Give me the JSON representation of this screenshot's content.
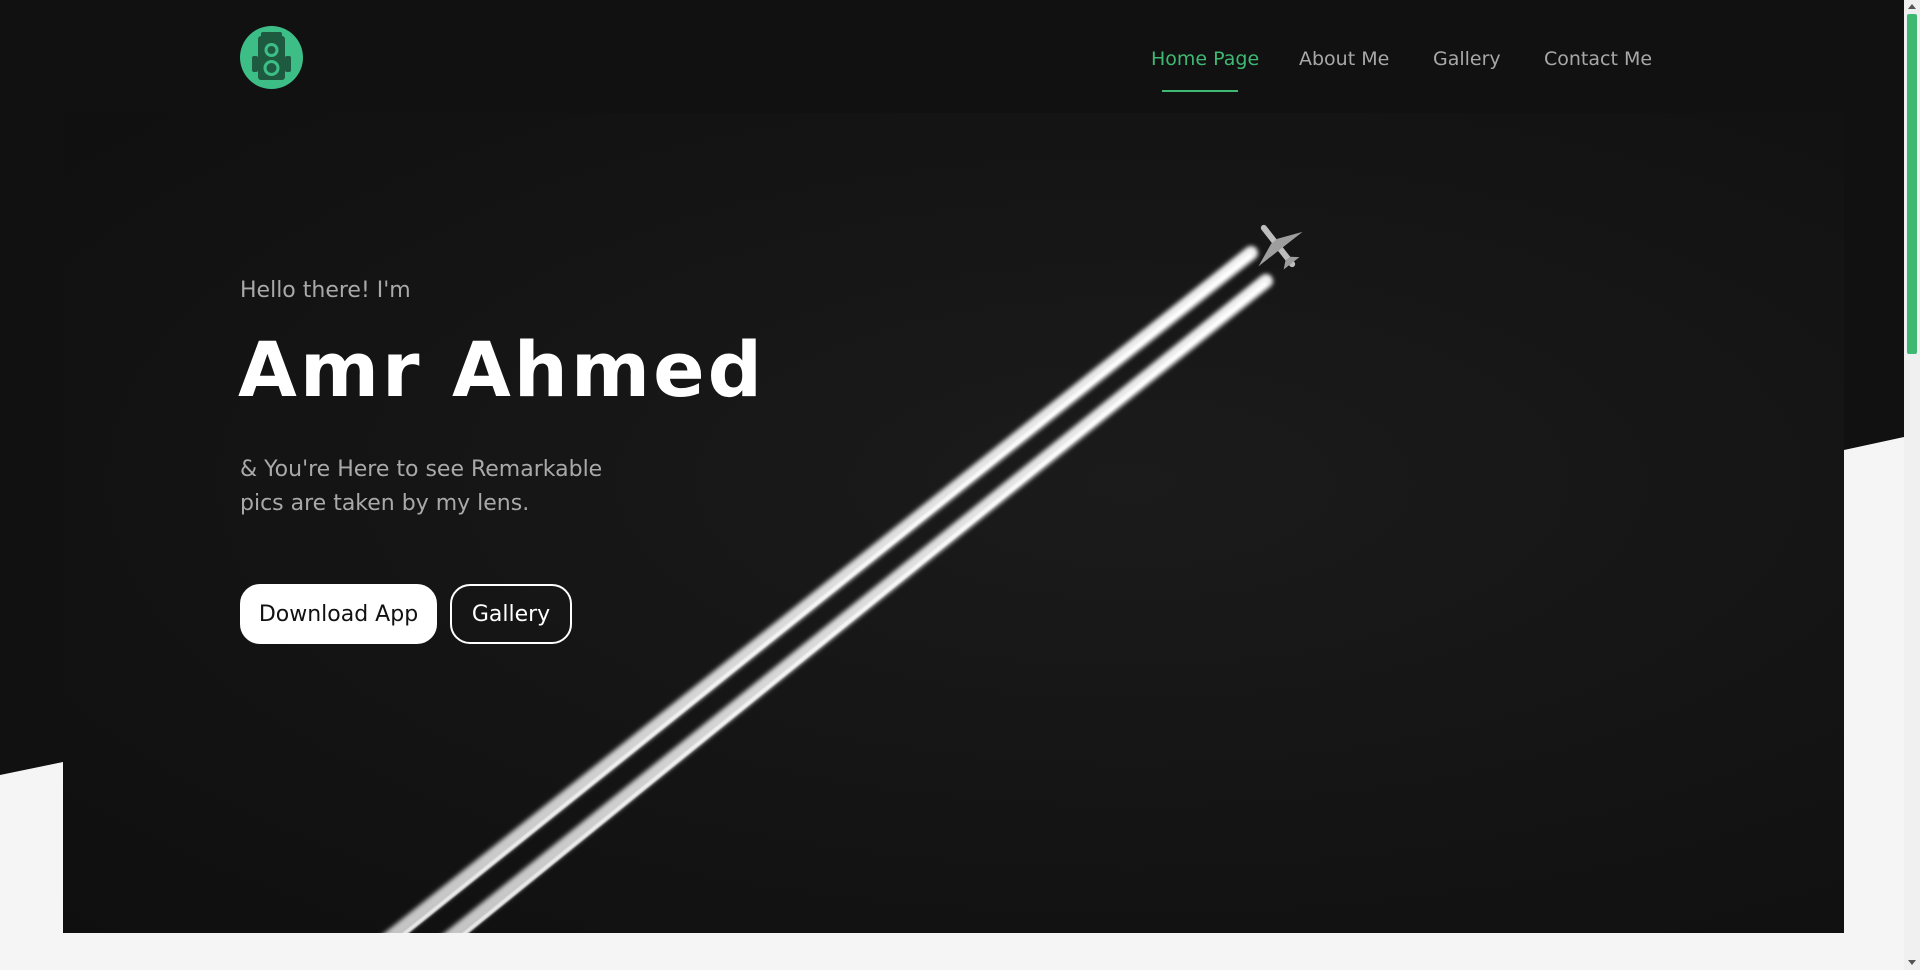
{
  "header": {
    "logo_icon": "camera-icon",
    "nav": [
      {
        "label": "Home Page",
        "active": true
      },
      {
        "label": "About Me",
        "active": false
      },
      {
        "label": "Gallery",
        "active": false
      },
      {
        "label": "Contact Me",
        "active": false
      }
    ]
  },
  "hero": {
    "intro": "Hello there! I'm",
    "name": "Amr Ahmed",
    "tagline": "& You're Here to see Remarkable pics are taken by my lens.",
    "buttons": {
      "primary": "Download App",
      "secondary": "Gallery"
    },
    "background_image": "airplane-contrails",
    "scroll_icon": "arrow-down-icon"
  },
  "colors": {
    "accent": "#3fb873",
    "logo": "#3dbe87",
    "background": "#111111",
    "text_muted": "#a9a9a9",
    "text_light": "#ffffff"
  }
}
